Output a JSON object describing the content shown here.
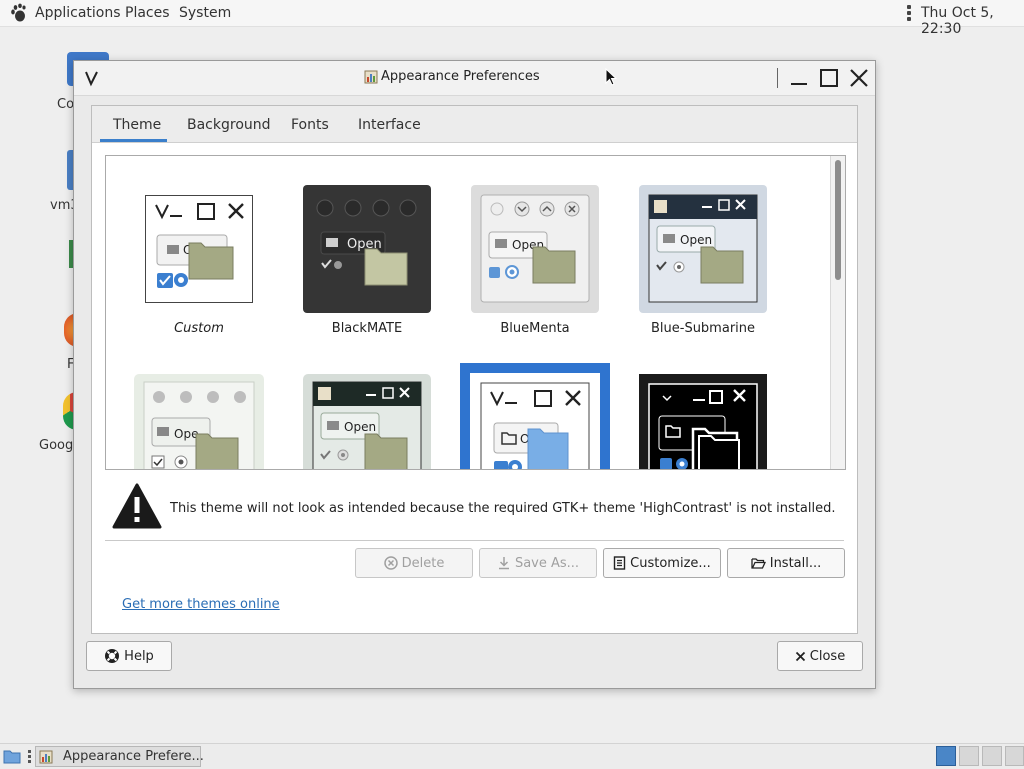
{
  "top_panel": {
    "menus": [
      "Applications",
      "Places",
      "System"
    ],
    "clock": "Thu Oct  5, 22:30"
  },
  "desktop": {
    "icon_labels": [
      "Co",
      "vm3",
      "F",
      "Goog"
    ]
  },
  "window": {
    "title": "Appearance Preferences",
    "tabs": [
      "Theme",
      "Background",
      "Fonts",
      "Interface"
    ],
    "active_tab": "Theme",
    "themes": [
      {
        "name": "Custom",
        "italic": true
      },
      {
        "name": "BlackMATE"
      },
      {
        "name": "BlueMenta"
      },
      {
        "name": "Blue-Submarine"
      }
    ],
    "thumb_labels": {
      "open": "Open",
      "open_short": "O",
      "open_clipped": "Ope"
    },
    "warning": "This theme will not look as intended because the required GTK+ theme 'HighContrast' is not installed.",
    "buttons": {
      "delete": "Delete",
      "save_as": "Save As...",
      "customize": "Customize...",
      "install": "Install...",
      "help": "Help",
      "close": "Close"
    },
    "link": "Get more themes online"
  },
  "taskbar": {
    "items": [
      "Appearance Prefere..."
    ],
    "workspaces": 4,
    "active_workspace": 1
  },
  "colors": {
    "accent": "#3a7fcb",
    "selection": "#2f74cf",
    "link": "#2a6db5"
  }
}
